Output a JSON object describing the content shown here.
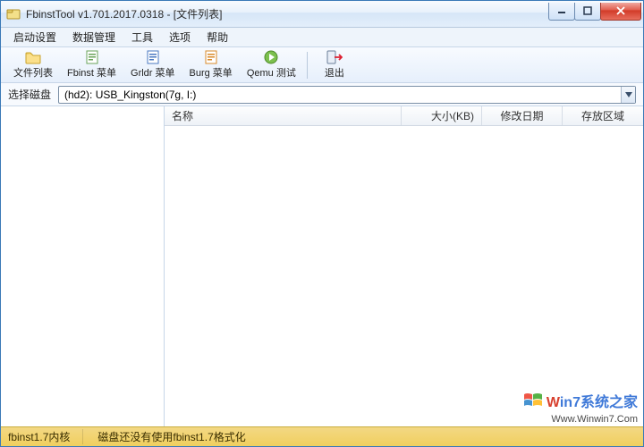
{
  "title": "FbinstTool v1.701.2017.0318 - [文件列表]",
  "menu": {
    "items": [
      "启动设置",
      "数据管理",
      "工具",
      "选项",
      "帮助"
    ]
  },
  "toolbar": {
    "items": [
      {
        "name": "file-list",
        "label": "文件列表"
      },
      {
        "name": "fbinst-menu",
        "label": "Fbinst 菜单"
      },
      {
        "name": "grldr-menu",
        "label": "Grldr 菜单"
      },
      {
        "name": "burg-menu",
        "label": "Burg 菜单"
      },
      {
        "name": "qemu-test",
        "label": "Qemu 测试"
      }
    ],
    "exit": "退出"
  },
  "disk": {
    "label": "选择磁盘",
    "value": "(hd2): USB_Kingston(7g, I:)"
  },
  "columns": {
    "name": "名称",
    "size": "大小(KB)",
    "date": "修改日期",
    "area": "存放区域"
  },
  "status": {
    "kernel": "fbinst1.7内核",
    "msg": "磁盘还没有使用fbinst1.7格式化"
  },
  "watermark": {
    "line1a": "W",
    "line1b": "in",
    "line1c": "7",
    "line1d": "系统之家",
    "line2": "Www.Winwin7.Com"
  }
}
